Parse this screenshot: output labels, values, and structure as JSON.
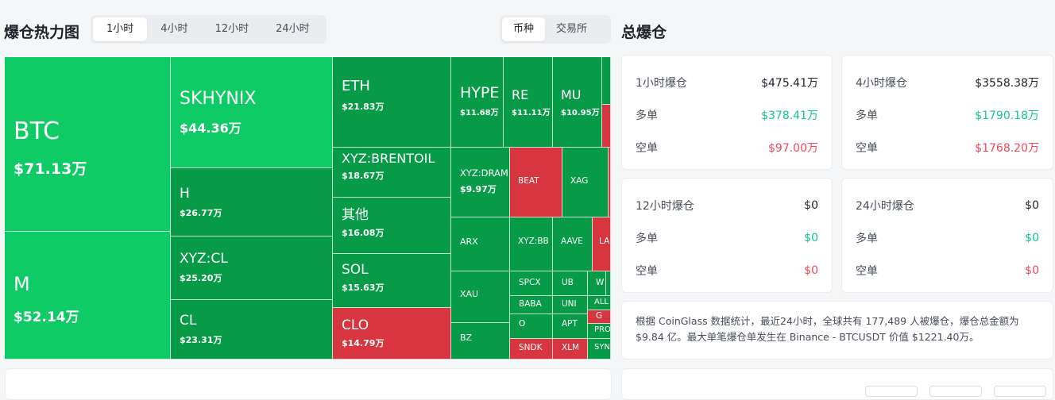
{
  "heatmap": {
    "title": "爆仓热力图",
    "time_tabs": [
      "1小时",
      "4小时",
      "12小时",
      "24小时"
    ],
    "active_time_tab": "1小时",
    "group_tabs": [
      "币种",
      "交易所"
    ],
    "active_group_tab": "币种",
    "colors": {
      "bright_green": "#0ecb65",
      "green": "#079b48",
      "red": "#d7353f"
    },
    "cells": [
      {
        "symbol": "BTC",
        "amount": "$71.13万",
        "color": "bright"
      },
      {
        "symbol": "M",
        "amount": "$52.14万",
        "color": "bright"
      },
      {
        "symbol": "SKHYNIX",
        "amount": "$44.36万",
        "color": "bright"
      },
      {
        "symbol": "H",
        "amount": "$26.77万",
        "color": "green"
      },
      {
        "symbol": "XYZ:CL",
        "amount": "$25.20万",
        "color": "green"
      },
      {
        "symbol": "CL",
        "amount": "$23.31万",
        "color": "green"
      },
      {
        "symbol": "ETH",
        "amount": "$21.83万",
        "color": "green"
      },
      {
        "symbol": "XYZ:BRENTOIL",
        "amount": "$18.67万",
        "color": "green"
      },
      {
        "symbol": "其他",
        "amount": "$16.08万",
        "color": "green"
      },
      {
        "symbol": "SOL",
        "amount": "$15.63万",
        "color": "green"
      },
      {
        "symbol": "CLO",
        "amount": "$14.79万",
        "color": "red"
      },
      {
        "symbol": "HYPE",
        "amount": "$11.68万",
        "color": "green"
      },
      {
        "symbol": "RE",
        "amount": "$11.11万",
        "color": "green"
      },
      {
        "symbol": "MU",
        "amount": "$10.95万",
        "color": "green"
      },
      {
        "symbol": "XYZ:DRAM",
        "amount": "$9.97万",
        "color": "green"
      },
      {
        "symbol": "BEAT",
        "amount": "",
        "color": "red"
      },
      {
        "symbol": "XAG",
        "amount": "",
        "color": "green"
      },
      {
        "symbol": "ARX",
        "amount": "",
        "color": "green"
      },
      {
        "symbol": "XYZ:BB",
        "amount": "",
        "color": "green"
      },
      {
        "symbol": "AAVE",
        "amount": "",
        "color": "green"
      },
      {
        "symbol": "LA",
        "amount": "",
        "color": "red"
      },
      {
        "symbol": "XAU",
        "amount": "",
        "color": "green"
      },
      {
        "symbol": "SPCX",
        "amount": "",
        "color": "green"
      },
      {
        "symbol": "UB",
        "amount": "",
        "color": "green"
      },
      {
        "symbol": "W",
        "amount": "",
        "color": "green"
      },
      {
        "symbol": "BABA",
        "amount": "",
        "color": "green"
      },
      {
        "symbol": "UNI",
        "amount": "",
        "color": "green"
      },
      {
        "symbol": "ALL",
        "amount": "",
        "color": "green"
      },
      {
        "symbol": "G",
        "amount": "",
        "color": "red"
      },
      {
        "symbol": "O",
        "amount": "",
        "color": "green"
      },
      {
        "symbol": "APT",
        "amount": "",
        "color": "green"
      },
      {
        "symbol": "PRO",
        "amount": "",
        "color": "green"
      },
      {
        "symbol": "BZ",
        "amount": "",
        "color": "green"
      },
      {
        "symbol": "SNDK",
        "amount": "",
        "color": "red"
      },
      {
        "symbol": "XLM",
        "amount": "",
        "color": "red"
      },
      {
        "symbol": "SYN",
        "amount": "",
        "color": "green"
      },
      {
        "symbol": "",
        "amount": "",
        "color": "green"
      },
      {
        "symbol": "",
        "amount": "",
        "color": "red"
      },
      {
        "symbol": "",
        "amount": "",
        "color": "red"
      },
      {
        "symbol": "",
        "amount": "",
        "color": "green"
      },
      {
        "symbol": "",
        "amount": "",
        "color": "red"
      }
    ]
  },
  "total": {
    "title": "总爆仓",
    "cards": [
      {
        "label": "1小时爆仓",
        "total": "$475.41万",
        "long_label": "多单",
        "long": "$378.41万",
        "short_label": "空单",
        "short": "$97.00万"
      },
      {
        "label": "4小时爆仓",
        "total": "$3558.38万",
        "long_label": "多单",
        "long": "$1790.18万",
        "short_label": "空单",
        "short": "$1768.20万"
      },
      {
        "label": "12小时爆仓",
        "total": "$0",
        "long_label": "多单",
        "long": "$0",
        "short_label": "空单",
        "short": "$0"
      },
      {
        "label": "24小时爆仓",
        "total": "$0",
        "long_label": "多单",
        "long": "$0",
        "short_label": "空单",
        "short": "$0"
      }
    ],
    "summary": "根据 CoinGlass 数据统计，最近24小时，全球共有 177,489 人被爆仓，爆仓总金额为 $9.84 亿。最大单笔爆仓单发生在 Binance - BTCUSDT 价值 $1221.40万。"
  }
}
